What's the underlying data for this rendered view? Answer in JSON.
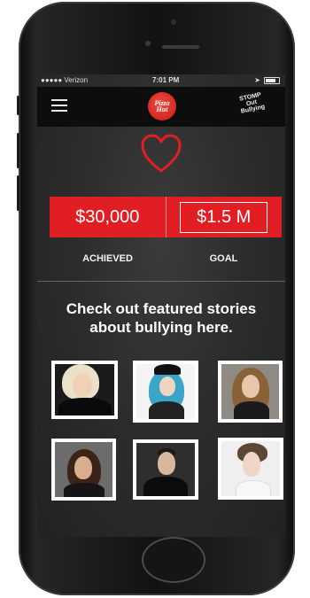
{
  "status_bar": {
    "carrier": "●●●●● Verizon",
    "time": "7:01 PM"
  },
  "header": {
    "logo_left_line1": "Pizza",
    "logo_left_line2": "Hut",
    "logo_right_line1": "STOMP",
    "logo_right_line2": "Out",
    "logo_right_line3": "Bullying"
  },
  "stats": {
    "achieved_value": "$30,000",
    "goal_value": "$1.5 M",
    "achieved_label": "ACHIEVED",
    "goal_label": "GOAL"
  },
  "headline": {
    "line1": "Check out featured stories",
    "line2": "about bullying here."
  },
  "colors": {
    "accent_red": "#e11e23",
    "screen_bg": "#2d2d2d",
    "navbar_bg": "#0d0d0d"
  },
  "icons": {
    "menu": "hamburger-icon",
    "heart": "heart-outline-icon"
  }
}
